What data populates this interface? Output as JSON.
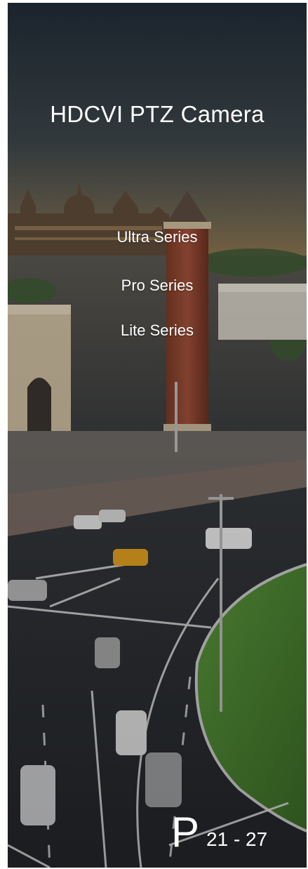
{
  "title": "HDCVI PTZ Camera",
  "series": [
    {
      "label": "Ultra Series"
    },
    {
      "label": "Pro Series"
    },
    {
      "label": "Lite Series"
    }
  ],
  "page_ref": {
    "letter": "P",
    "range": "21 - 27"
  },
  "colors": {
    "text": "#ffffff",
    "sky_top": "#1f2b36",
    "grass": "#4f8a34",
    "road": "#2a2e34"
  }
}
